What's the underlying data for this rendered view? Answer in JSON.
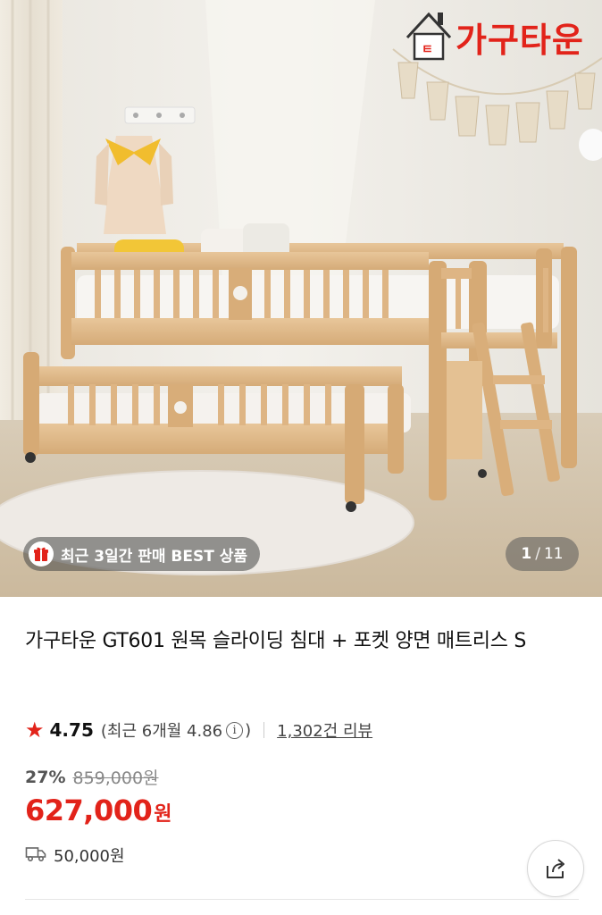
{
  "hero": {
    "brand_name": "가구타운",
    "badge_text": "최근 3일간 판매 BEST 상품",
    "badge_icon": "gift-icon",
    "page_current": "1",
    "page_separator": "/",
    "page_total": "11"
  },
  "product": {
    "title": "가구타운 GT601 원목 슬라이딩 침대 + 포켓 양면 매트리스 S",
    "rating": "4.75",
    "recent_rating_label": "(최근 6개월 4.86",
    "recent_rating_close": ")",
    "review_count": "1,302건 리뷰",
    "discount_rate": "27%",
    "original_price": "859,000원",
    "price": "627,000",
    "price_unit": "원",
    "shipping_fee": "50,000원"
  },
  "colors": {
    "accent": "#e2231a",
    "text": "#111111",
    "muted": "#888888"
  },
  "icons": {
    "rating": "star-icon",
    "info": "info-icon",
    "shipping": "truck-icon",
    "share": "share-icon"
  }
}
